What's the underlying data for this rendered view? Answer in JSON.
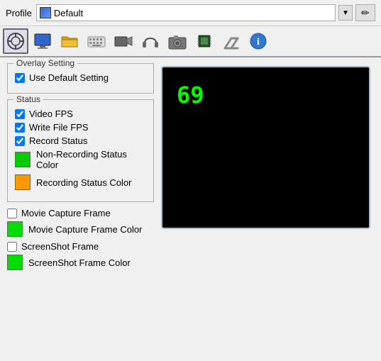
{
  "topbar": {
    "profile_label": "Profile",
    "profile_name": "Default",
    "dropdown_arrow": "▼",
    "edit_icon": "✏"
  },
  "toolbar": {
    "tabs": [
      {
        "name": "overlay",
        "label": "Overlay",
        "active": true
      },
      {
        "name": "display",
        "label": "Display"
      },
      {
        "name": "folder",
        "label": "Folder"
      },
      {
        "name": "keyboard",
        "label": "Keyboard"
      },
      {
        "name": "video",
        "label": "Video"
      },
      {
        "name": "audio",
        "label": "Audio"
      },
      {
        "name": "camera",
        "label": "Camera"
      },
      {
        "name": "hardware",
        "label": "Hardware"
      },
      {
        "name": "tools",
        "label": "Tools"
      },
      {
        "name": "info",
        "label": "Info"
      }
    ]
  },
  "overlay_setting": {
    "group_label": "Overlay Setting",
    "use_default_label": "Use Default Setting",
    "use_default_checked": true
  },
  "status": {
    "group_label": "Status",
    "video_fps_label": "Video FPS",
    "video_fps_checked": true,
    "write_file_fps_label": "Write File FPS",
    "write_file_fps_checked": true,
    "record_status_label": "Record Status",
    "record_status_checked": true,
    "non_recording_color_label": "Non-Recording Status Color",
    "non_recording_color": "#00cc00",
    "recording_color_label": "Recording Status Color",
    "recording_color": "#ff9900"
  },
  "movie_capture": {
    "frame_label": "Movie Capture Frame",
    "frame_checked": false,
    "frame_color_label": "Movie Capture Frame Color",
    "frame_color": "#00dd00"
  },
  "screenshot": {
    "frame_label": "ScreenShot Frame",
    "frame_checked": false,
    "frame_color_label": "ScreenShot Frame Color",
    "frame_color": "#00dd00"
  },
  "preview": {
    "number": "69"
  }
}
